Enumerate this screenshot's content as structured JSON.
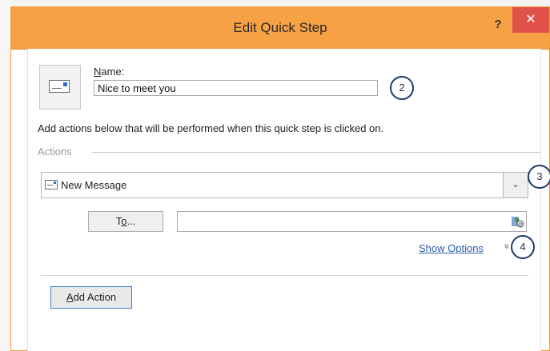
{
  "dialog": {
    "title": "Edit Quick Step",
    "help_glyph": "?",
    "close_glyph": "✕"
  },
  "name_section": {
    "label_accel": "N",
    "label_rest": "ame:",
    "value": "Nice to meet you"
  },
  "instructions": "Add actions below that will be performed when this quick step is clicked on.",
  "actions": {
    "section_label": "Actions",
    "selected_action": "New Message",
    "dropdown_glyph": "⌄",
    "to_button_prefix": "T",
    "to_button_accel": "o",
    "to_button_suffix": "...",
    "to_value": "",
    "show_options_label": "Show Options",
    "chevrons_glyph": "»"
  },
  "add_action": {
    "label_accel": "A",
    "label_rest": "dd Action"
  },
  "callouts": [
    "2",
    "3",
    "4"
  ],
  "colors": {
    "titlebar": "#f5a144",
    "close_button": "#e0524a",
    "link": "#2a5aa8",
    "callout_border": "#1f3a6b"
  },
  "icons": {
    "quick_step": "envelope-icon",
    "action": "new-message-icon",
    "address_book": "address-book-icon"
  }
}
